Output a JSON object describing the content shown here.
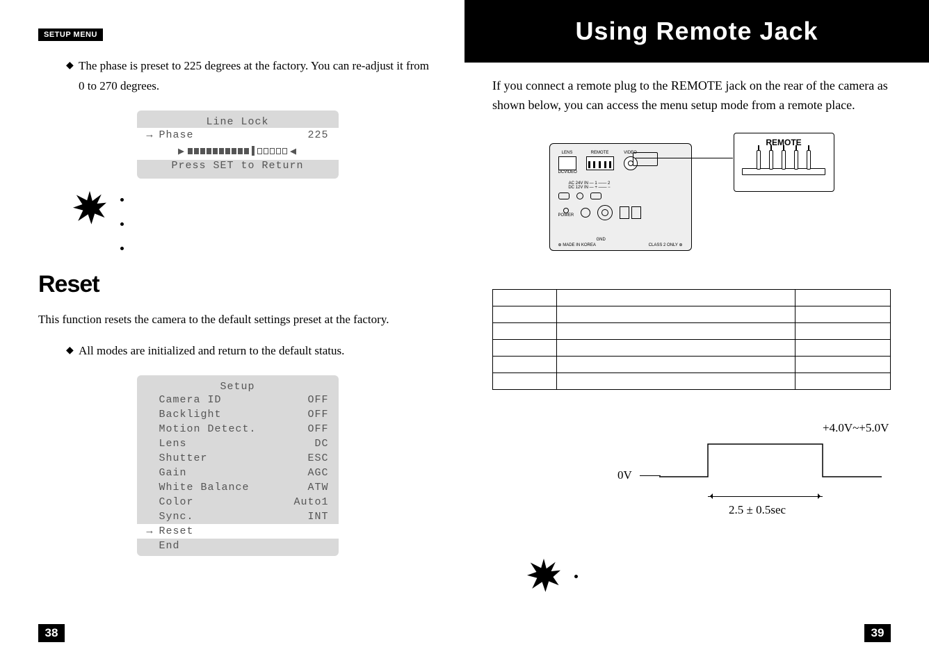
{
  "left": {
    "tag": "SETUP MENU",
    "bullet": "The phase is preset to 225 degrees at the factory. You can re-adjust it from 0 to 270 degrees.",
    "lcd1": {
      "title": "Line Lock",
      "row_label": "Phase",
      "row_value": "225",
      "footer": "Press SET to Return"
    },
    "reset_heading": "Reset",
    "reset_para": "This function resets the camera to the default settings preset at the factory.",
    "reset_bullet": "All modes are initialized and return to the default status.",
    "lcd2": {
      "title": "Setup",
      "rows": [
        {
          "label": "Camera ID",
          "val": "OFF"
        },
        {
          "label": "Backlight",
          "val": "OFF"
        },
        {
          "label": "Motion Detect.",
          "val": "OFF"
        },
        {
          "label": "Lens",
          "val": "DC"
        },
        {
          "label": "Shutter",
          "val": "ESC"
        },
        {
          "label": "Gain",
          "val": "AGC"
        },
        {
          "label": "White Balance",
          "val": "ATW"
        },
        {
          "label": "Color",
          "val": "Auto1"
        },
        {
          "label": "Sync.",
          "val": "INT"
        }
      ],
      "reset_row": "Reset",
      "end_row": "End"
    },
    "page_num": "38"
  },
  "right": {
    "title": "Using Remote Jack",
    "intro": "If you connect a remote plug to the REMOTE jack on the rear of the camera as shown below, you can access the menu setup mode from a remote place.",
    "diagram": {
      "remote_label": "REMOTE",
      "back_labels": {
        "lens": "LENS",
        "remote": "REMOTE",
        "video": "VIDEO",
        "dc": "DC",
        "ac": "AC 24V IN",
        "dcv": "DC 12V IN",
        "gnd": "GND",
        "power": "POWER",
        "made": "MADE IN KOREA",
        "class": "CLASS 2 ONLY"
      }
    },
    "timing": {
      "zero": "0V",
      "high": "+4.0V~+5.0V",
      "duration": "2.5 ± 0.5sec"
    },
    "page_num": "39"
  }
}
